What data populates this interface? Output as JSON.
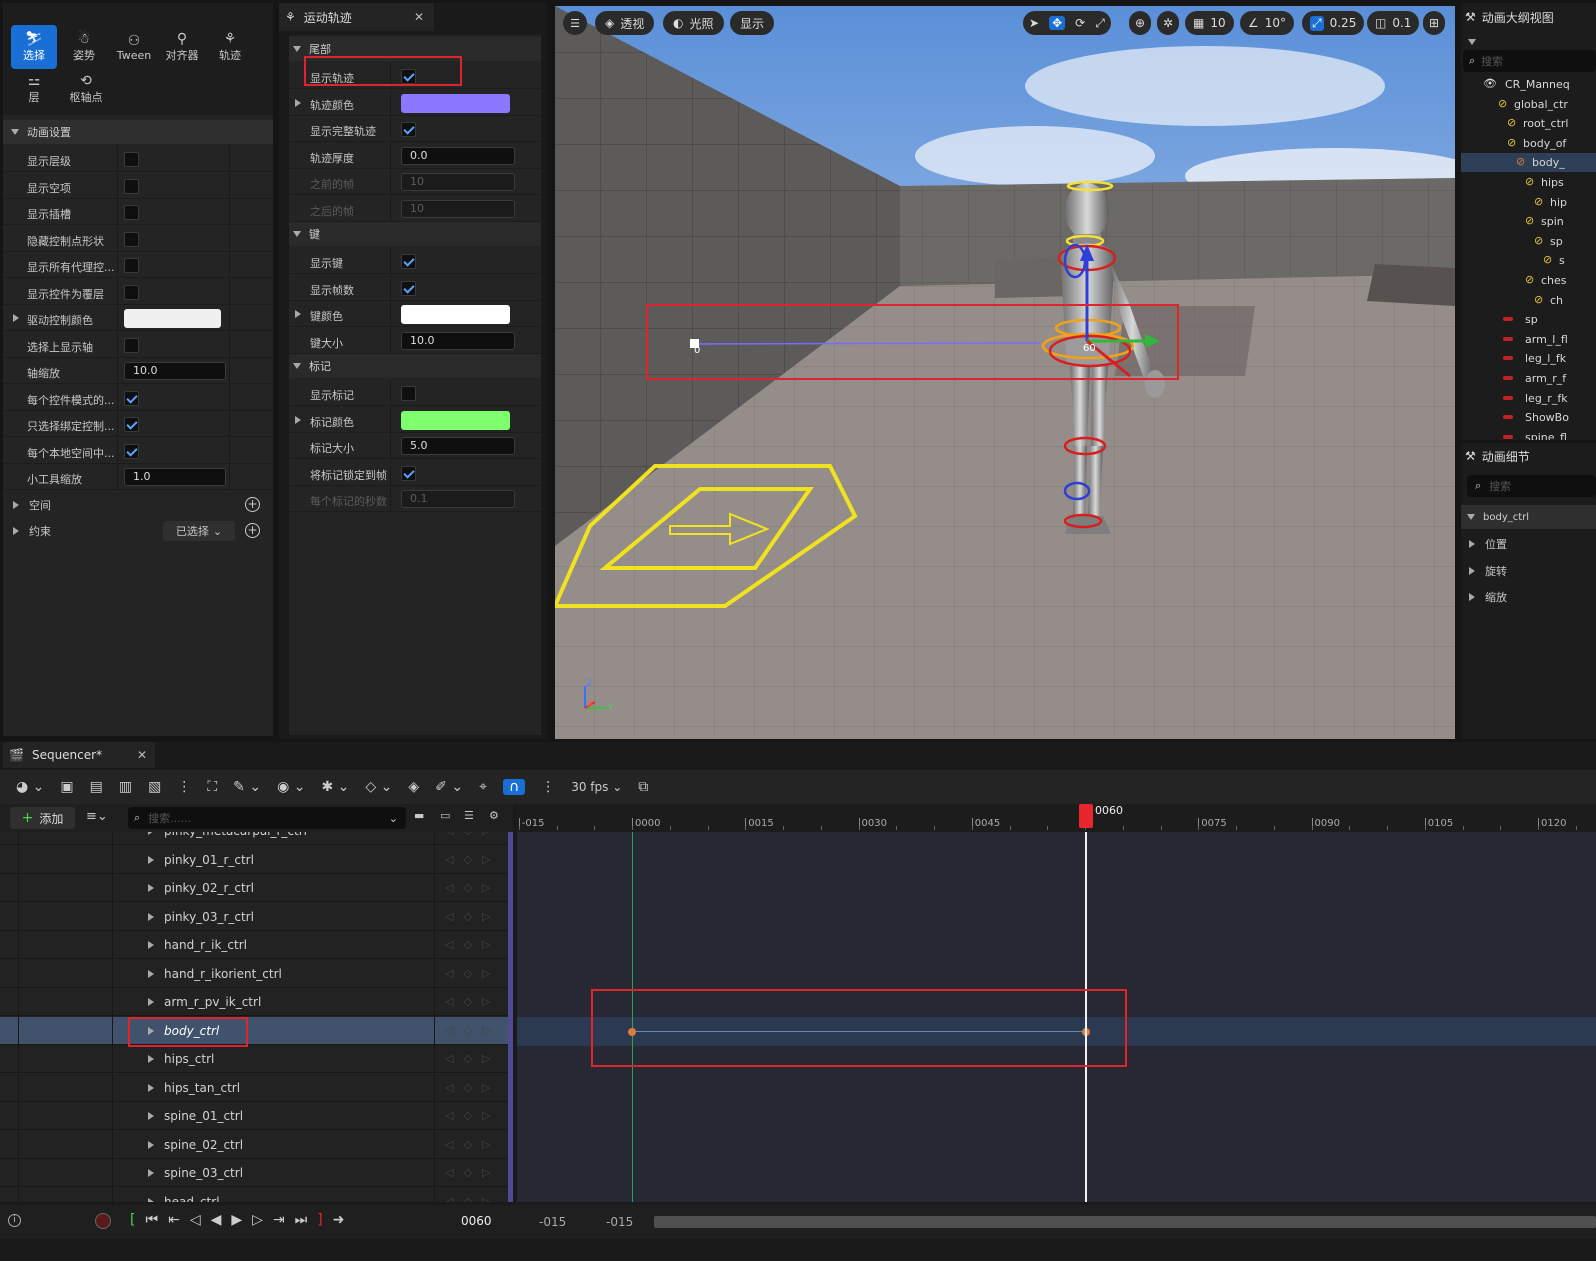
{
  "toolbar_modes": {
    "select": "选择",
    "pose": "姿势",
    "tween": "Tween",
    "aligner": "对齐器",
    "trail": "轨迹",
    "layer": "层",
    "pivot": "枢轴点"
  },
  "anim_settings": {
    "header": "动画设置",
    "rows": [
      {
        "label": "显示层级",
        "type": "check",
        "checked": false
      },
      {
        "label": "显示空项",
        "type": "check",
        "checked": false
      },
      {
        "label": "显示插槽",
        "type": "check",
        "checked": false
      },
      {
        "label": "隐藏控制点形状",
        "type": "check",
        "checked": false
      },
      {
        "label": "显示所有代理控...",
        "type": "check",
        "checked": false
      },
      {
        "label": "显示控件为覆层",
        "type": "check",
        "checked": false
      },
      {
        "label": "驱动控制颜色",
        "type": "color",
        "color": "#f0f0f0"
      },
      {
        "label": "选择上显示轴",
        "type": "check",
        "checked": false
      },
      {
        "label": "轴缩放",
        "type": "num",
        "value": "10.0"
      },
      {
        "label": "每个控件模式的...",
        "type": "check",
        "checked": true
      },
      {
        "label": "只选择绑定控制...",
        "type": "check",
        "checked": true
      },
      {
        "label": "每个本地空间中...",
        "type": "check",
        "checked": true
      },
      {
        "label": "小工具缩放",
        "type": "num",
        "value": "1.0"
      }
    ],
    "space": "空间",
    "constraint": "约束",
    "selected_dropdown": "已选择"
  },
  "motion_trail": {
    "tab_title": "运动轨迹",
    "sections": [
      {
        "title": "尾部",
        "rows": [
          {
            "label": "显示轨迹",
            "type": "check",
            "checked": true
          },
          {
            "label": "轨迹颜色",
            "type": "color",
            "color": "#8c78ff",
            "expand": true
          },
          {
            "label": "显示完整轨迹",
            "type": "check",
            "checked": true
          },
          {
            "label": "轨迹厚度",
            "type": "num",
            "value": "0.0"
          },
          {
            "label": "之前的帧",
            "type": "num",
            "value": "10",
            "disabled": true
          },
          {
            "label": "之后的帧",
            "type": "num",
            "value": "10",
            "disabled": true
          }
        ]
      },
      {
        "title": "键",
        "rows": [
          {
            "label": "显示键",
            "type": "check",
            "checked": true
          },
          {
            "label": "显示帧数",
            "type": "check",
            "checked": true
          },
          {
            "label": "键颜色",
            "type": "color",
            "color": "#ffffff",
            "expand": true
          },
          {
            "label": "键大小",
            "type": "num",
            "value": "10.0"
          }
        ]
      },
      {
        "title": "标记",
        "rows": [
          {
            "label": "显示标记",
            "type": "check",
            "checked": false
          },
          {
            "label": "标记颜色",
            "type": "color",
            "color": "#7dff6e",
            "expand": true
          },
          {
            "label": "标记大小",
            "type": "num",
            "value": "5.0"
          },
          {
            "label": "将标记锁定到帧",
            "type": "check",
            "checked": true
          },
          {
            "label": "每个标记的秒数",
            "type": "num",
            "value": "0.1",
            "disabled": true
          }
        ]
      }
    ]
  },
  "viewport": {
    "perspective": "透视",
    "lighting": "光照",
    "show": "显示",
    "grid_snap": "10",
    "rot_snap": "10°",
    "scale_snap": "0.25",
    "cam_speed": "0.1",
    "frame_label": "0",
    "frame_label_60": "60",
    "axis_z": "Z",
    "axis_x": "X",
    "axis_y": "Y"
  },
  "outliner": {
    "title": "动画大纲视图",
    "search_placeholder": "搜索",
    "items": [
      {
        "label": "CR_Manneq",
        "indent": 0,
        "eye": true
      },
      {
        "label": "global_ctr",
        "indent": 1
      },
      {
        "label": "root_ctrl",
        "indent": 2
      },
      {
        "label": "body_of",
        "indent": 2
      },
      {
        "label": "body_",
        "indent": 3,
        "selected": true
      },
      {
        "label": "hips",
        "indent": 4
      },
      {
        "label": "hip",
        "indent": 5
      },
      {
        "label": "spin",
        "indent": 4
      },
      {
        "label": "sp",
        "indent": 5
      },
      {
        "label": "s",
        "indent": 6
      },
      {
        "label": "ches",
        "indent": 4
      },
      {
        "label": "ch",
        "indent": 5
      },
      {
        "label": "sp",
        "indent": 5,
        "red": true
      },
      {
        "label": "arm_l_fl",
        "indent": 1,
        "red": true
      },
      {
        "label": "leg_l_fk",
        "indent": 1,
        "red": true
      },
      {
        "label": "arm_r_f",
        "indent": 1,
        "red": true
      },
      {
        "label": "leg_r_fk",
        "indent": 1,
        "red": true
      },
      {
        "label": "ShowBo",
        "indent": 1,
        "red": true
      },
      {
        "label": "spine_fl",
        "indent": 1,
        "red": true
      }
    ]
  },
  "anim_details": {
    "title": "动画细节",
    "search_placeholder": "搜索",
    "control": "body_ctrl",
    "groups": [
      "位置",
      "旋转",
      "缩放"
    ]
  },
  "sequencer": {
    "tab_title": "Sequencer*",
    "add_label": "添加",
    "search_placeholder": "搜索......",
    "fps": "30 fps",
    "current_frame": "0060",
    "ruler_labels": [
      "-015",
      "0000",
      "0015",
      "0030",
      "0045",
      "0075",
      "0090",
      "0105",
      "0120"
    ],
    "tracks": [
      "pinky_metacarpal_r_ctrl",
      "pinky_01_r_ctrl",
      "pinky_02_r_ctrl",
      "pinky_03_r_ctrl",
      "hand_r_ik_ctrl",
      "hand_r_ikorient_ctrl",
      "arm_r_pv_ik_ctrl",
      "body_ctrl",
      "hips_ctrl",
      "hips_tan_ctrl",
      "spine_01_ctrl",
      "spine_02_ctrl",
      "spine_03_ctrl",
      "head_ctrl"
    ],
    "selected_track": "body_ctrl",
    "playback_frame": "0060",
    "range_start": "-015",
    "range_end": "-015"
  }
}
